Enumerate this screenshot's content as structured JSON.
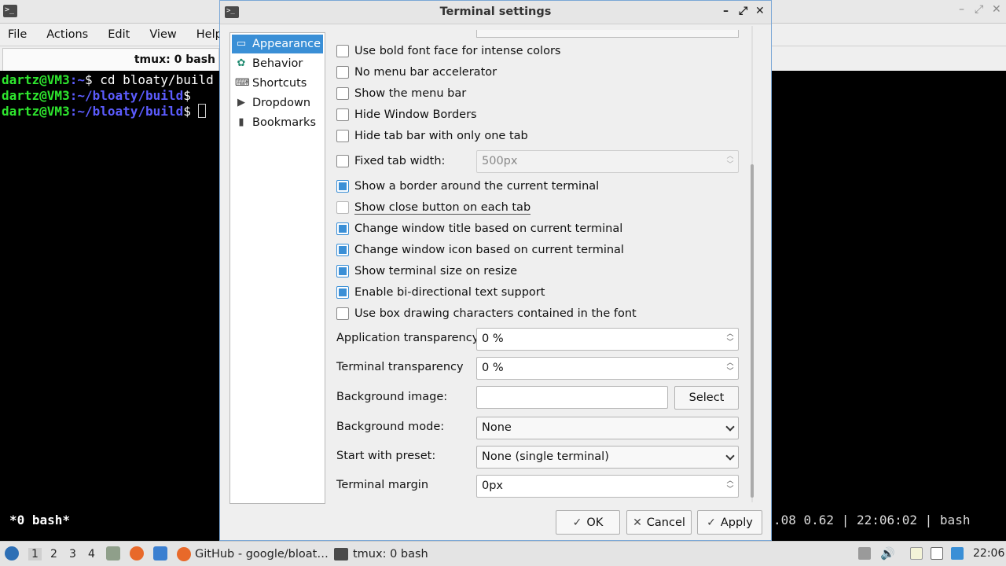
{
  "bg_window": {
    "menu": [
      "File",
      "Actions",
      "Edit",
      "View",
      "Help"
    ],
    "tab_title": "tmux: 0 bash",
    "lines": [
      {
        "user": "dartz@VM3",
        "path": ":~",
        "rest": "$ cd bloaty/build"
      },
      {
        "user": "dartz@VM3",
        "path": ":~/bloaty/build",
        "rest": "$"
      },
      {
        "user": "dartz@VM3",
        "path": ":~/bloaty/build",
        "rest": "$ "
      }
    ],
    "status_left": "*0 bash*",
    "status_right": ".08 0.62 | 22:06:02 | bash"
  },
  "dialog": {
    "title": "Terminal settings",
    "sidebar": [
      {
        "label": "Appearance",
        "icon": "appearance-icon",
        "active": true
      },
      {
        "label": "Behavior",
        "icon": "behavior-icon",
        "active": false
      },
      {
        "label": "Shortcuts",
        "icon": "keyboard-icon",
        "active": false
      },
      {
        "label": "Dropdown",
        "icon": "dropdown-icon",
        "active": false
      },
      {
        "label": "Bookmarks",
        "icon": "bookmark-icon",
        "active": false
      }
    ],
    "checkboxes": [
      {
        "label": "Use bold font face for intense colors",
        "checked": false
      },
      {
        "label": "No menu bar accelerator",
        "checked": false
      },
      {
        "label": "Show the menu bar",
        "checked": false
      },
      {
        "label": "Hide Window Borders",
        "checked": false
      },
      {
        "label": "Hide tab bar with only one tab",
        "checked": false
      },
      {
        "label": "Fixed tab width:",
        "checked": false
      },
      {
        "label": "Show a border around the current terminal",
        "checked": true
      },
      {
        "label": "Show close button on each tab",
        "checked": false
      },
      {
        "label": "Change window title based on current terminal",
        "checked": true
      },
      {
        "label": "Change window icon based on current terminal",
        "checked": true
      },
      {
        "label": "Show terminal size on resize",
        "checked": true
      },
      {
        "label": "Enable bi-directional text support",
        "checked": true
      },
      {
        "label": "Use box drawing characters contained in the font",
        "checked": false
      }
    ],
    "fixed_tab_width_value": "500px",
    "fields": {
      "app_transparency_label": "Application transparency",
      "app_transparency_value": "0 %",
      "term_transparency_label": "Terminal transparency",
      "term_transparency_value": "0 %",
      "bg_image_label": "Background image:",
      "bg_image_value": "",
      "select_label": "Select",
      "bg_mode_label": "Background mode:",
      "bg_mode_value": "None",
      "preset_label": "Start with preset:",
      "preset_value": "None (single terminal)",
      "margin_label": "Terminal margin",
      "margin_value": "0px"
    },
    "buttons": {
      "ok": "OK",
      "cancel": "Cancel",
      "apply": "Apply"
    }
  },
  "taskbar": {
    "workspaces": [
      "1",
      "2",
      "3",
      "4"
    ],
    "tasks": [
      {
        "label": "GitHub - google/bloat…",
        "icon": "firefox-icon"
      },
      {
        "label": "tmux: 0 bash",
        "icon": "terminal-icon"
      }
    ],
    "clock": "22:06"
  },
  "colors": {
    "accent": "#3a8fd6",
    "prompt_user": "#2ee62e",
    "prompt_path": "#5c5cff"
  }
}
